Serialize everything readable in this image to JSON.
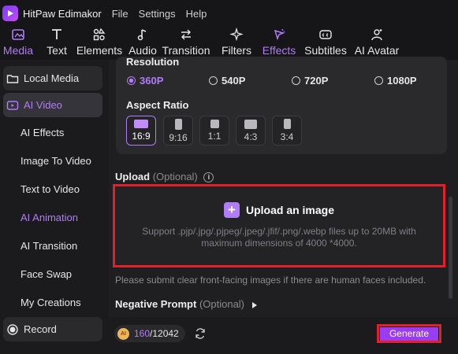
{
  "titlebar": {
    "app_name": "HitPaw Edimakor",
    "menus": [
      "File",
      "Settings",
      "Help"
    ]
  },
  "toolbar": {
    "tools": [
      {
        "label": "Media",
        "icon": "media-icon",
        "active": true
      },
      {
        "label": "Text",
        "icon": "text-icon"
      },
      {
        "label": "Elements",
        "icon": "elements-icon"
      },
      {
        "label": "Audio",
        "icon": "audio-icon"
      },
      {
        "label": "Transition",
        "icon": "transition-icon"
      },
      {
        "label": "Filters",
        "icon": "filters-icon"
      },
      {
        "label": "Effects",
        "icon": "effects-icon"
      },
      {
        "label": "Subtitles",
        "icon": "subtitles-icon"
      },
      {
        "label": "AI Avatar",
        "icon": "ai-avatar-icon"
      }
    ]
  },
  "sidebar": {
    "items": [
      {
        "label": "Local Media",
        "icon": "folder-icon"
      },
      {
        "label": "AI Video",
        "icon": "ai-video-icon",
        "selected": true
      },
      {
        "label": "AI Effects"
      },
      {
        "label": "Image To Video"
      },
      {
        "label": "Text to Video"
      },
      {
        "label": "AI Animation",
        "active": true
      },
      {
        "label": "AI Transition"
      },
      {
        "label": "Face Swap"
      },
      {
        "label": "My Creations"
      },
      {
        "label": "Record",
        "icon": "record-icon"
      }
    ]
  },
  "resolution": {
    "label": "Resolution",
    "options": [
      "360P",
      "540P",
      "720P",
      "1080P"
    ],
    "selected": "360P"
  },
  "aspect_ratio": {
    "label": "Aspect Ratio",
    "options": [
      "16:9",
      "9:16",
      "1:1",
      "4:3",
      "3:4"
    ],
    "selected": "16:9"
  },
  "upload": {
    "label": "Upload",
    "optional": "(Optional)",
    "title": "Upload an image",
    "description": "Support .pjp/.jpg/.pjpeg/.jpeg/.jfif/.png/.webp files up to 20MB with maximum dimensions of 4000 *4000.",
    "hint": "Please submit clear front-facing images if there are human faces included."
  },
  "negative_prompt": {
    "label": "Negative Prompt",
    "optional": "(Optional)"
  },
  "footer": {
    "badge": "AI",
    "credits_used": "160",
    "credits_total": "/12042",
    "generate_label": "Generate"
  },
  "colors": {
    "accent": "#b07cf7",
    "highlight_border": "#e0202b",
    "generate_bg": "#9a3cf2"
  }
}
